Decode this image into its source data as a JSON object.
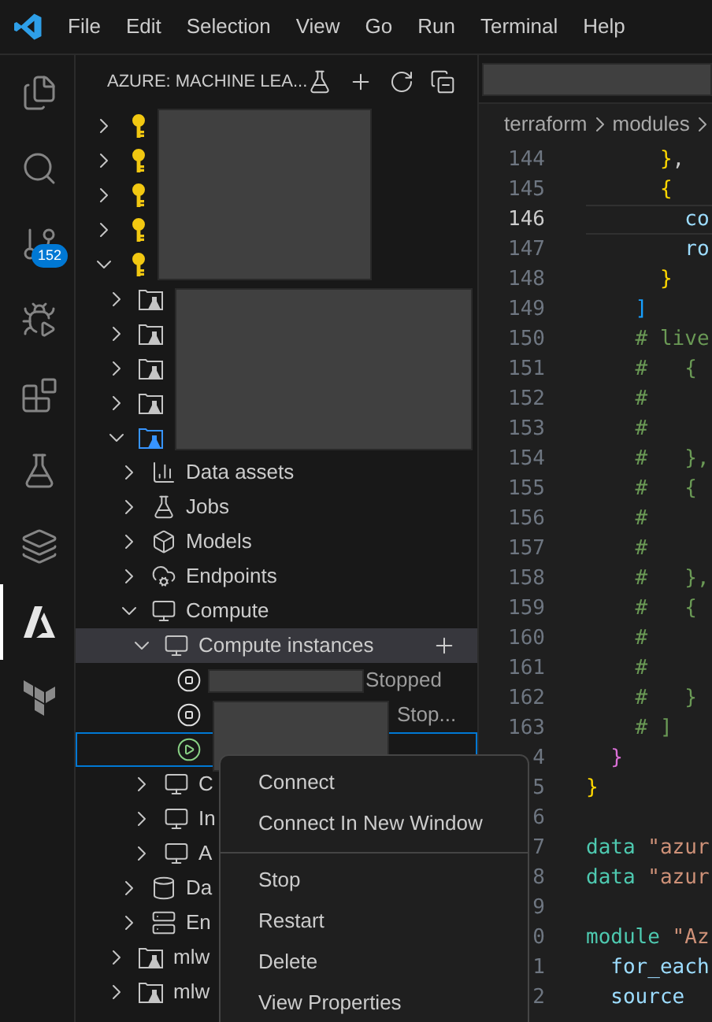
{
  "title_bar": {
    "menus": [
      "File",
      "Edit",
      "Selection",
      "View",
      "Go",
      "Run",
      "Terminal",
      "Help"
    ]
  },
  "activity_bar": [
    {
      "kind": "explorer",
      "selected": false
    },
    {
      "kind": "search",
      "selected": false
    },
    {
      "kind": "scm",
      "selected": false,
      "badge": "152"
    },
    {
      "kind": "debug",
      "selected": false
    },
    {
      "kind": "extensions",
      "selected": false
    },
    {
      "kind": "testing",
      "selected": false
    },
    {
      "kind": "layers",
      "selected": false
    },
    {
      "kind": "azure",
      "selected": true
    },
    {
      "kind": "terraform",
      "selected": false
    }
  ],
  "sidebar": {
    "title": "AZURE: MACHINE LEA...",
    "tree": [
      {
        "kind": "subscription",
        "expanded": false,
        "selected": false
      },
      {
        "kind": "subscription",
        "expanded": false,
        "selected": false
      },
      {
        "kind": "subscription",
        "expanded": false,
        "selected": false
      },
      {
        "kind": "subscription",
        "expanded": false,
        "selected": false
      },
      {
        "kind": "subscription",
        "expanded": true,
        "selected": false,
        "children": [
          {
            "kind": "workspace",
            "expanded": false,
            "selected": false
          },
          {
            "kind": "workspace",
            "expanded": false,
            "selected": false
          },
          {
            "kind": "workspace",
            "expanded": false,
            "selected": false
          },
          {
            "kind": "workspace",
            "expanded": false,
            "selected": false
          },
          {
            "kind": "defaultworkspace",
            "expanded": true,
            "selected": false,
            "children": [
              {
                "kind": "data",
                "label": "Data assets",
                "expanded": false,
                "selected": false
              },
              {
                "kind": "jobs",
                "label": "Jobs",
                "expanded": false,
                "selected": false
              },
              {
                "kind": "models",
                "label": "Models",
                "expanded": false,
                "selected": false
              },
              {
                "kind": "endpoints",
                "label": "Endpoints",
                "expanded": false,
                "selected": false
              },
              {
                "kind": "compute",
                "label": "Compute",
                "expanded": true,
                "selected": false,
                "children": [
                  {
                    "kind": "compute",
                    "label": "Compute instances",
                    "expanded": true,
                    "selected": true,
                    "add_button": true,
                    "children": [
                      {
                        "kind": "stoppedinstance",
                        "status": "Stopped",
                        "selected": false,
                        "focused": false
                      },
                      {
                        "kind": "stoppedinstance",
                        "status": "Stop...",
                        "selected": false,
                        "focused": false
                      },
                      {
                        "kind": "runninginstance",
                        "selected": false,
                        "focused": true
                      }
                    ]
                  },
                  {
                    "kind": "compute",
                    "label": "C",
                    "expanded": false,
                    "selected": false
                  },
                  {
                    "kind": "compute",
                    "label": "In",
                    "expanded": false,
                    "selected": false
                  },
                  {
                    "kind": "compute",
                    "label": "A",
                    "expanded": false,
                    "selected": false
                  }
                ]
              },
              {
                "kind": "datastore",
                "label": "Da",
                "expanded": false,
                "selected": false
              },
              {
                "kind": "environment",
                "label": "En",
                "expanded": false,
                "selected": false
              }
            ]
          },
          {
            "kind": "workspace",
            "label": "mlw",
            "expanded": false,
            "selected": false
          },
          {
            "kind": "workspace",
            "label": "mlw",
            "expanded": false,
            "selected": false
          }
        ]
      }
    ]
  },
  "editor": {
    "breadcrumbs": [
      "terraform",
      "modules"
    ],
    "lines": [
      {
        "n": "144",
        "current": false,
        "tokens": [
          {
            "text": "      }",
            "kind": "gold"
          },
          {
            "text": ",",
            "kind": "plain"
          }
        ]
      },
      {
        "n": "145",
        "current": false,
        "tokens": [
          {
            "text": "      {",
            "kind": "gold"
          }
        ]
      },
      {
        "n": "146",
        "current": true,
        "tokens": [
          {
            "text": "        co",
            "kind": "property"
          }
        ]
      },
      {
        "n": "147",
        "current": false,
        "tokens": [
          {
            "text": "        ro",
            "kind": "property"
          }
        ]
      },
      {
        "n": "148",
        "current": false,
        "tokens": [
          {
            "text": "      }",
            "kind": "gold"
          }
        ]
      },
      {
        "n": "149",
        "current": false,
        "tokens": [
          {
            "text": "    ]",
            "kind": "blue"
          }
        ]
      },
      {
        "n": "150",
        "current": false,
        "tokens": [
          {
            "text": "    # live",
            "kind": "comment"
          }
        ]
      },
      {
        "n": "151",
        "current": false,
        "tokens": [
          {
            "text": "    #   {",
            "kind": "comment"
          }
        ]
      },
      {
        "n": "152",
        "current": false,
        "tokens": [
          {
            "text": "    #",
            "kind": "comment"
          }
        ]
      },
      {
        "n": "153",
        "current": false,
        "tokens": [
          {
            "text": "    #",
            "kind": "comment"
          }
        ]
      },
      {
        "n": "154",
        "current": false,
        "tokens": [
          {
            "text": "    #   },",
            "kind": "comment"
          }
        ]
      },
      {
        "n": "155",
        "current": false,
        "tokens": [
          {
            "text": "    #   {",
            "kind": "comment"
          }
        ]
      },
      {
        "n": "156",
        "current": false,
        "tokens": [
          {
            "text": "    #",
            "kind": "comment"
          }
        ]
      },
      {
        "n": "157",
        "current": false,
        "tokens": [
          {
            "text": "    #",
            "kind": "comment"
          }
        ]
      },
      {
        "n": "158",
        "current": false,
        "tokens": [
          {
            "text": "    #   },",
            "kind": "comment"
          }
        ]
      },
      {
        "n": "159",
        "current": false,
        "tokens": [
          {
            "text": "    #   {",
            "kind": "comment"
          }
        ]
      },
      {
        "n": "160",
        "current": false,
        "tokens": [
          {
            "text": "    #",
            "kind": "comment"
          }
        ]
      },
      {
        "n": "161",
        "current": false,
        "tokens": [
          {
            "text": "    #",
            "kind": "comment"
          }
        ]
      },
      {
        "n": "162",
        "current": false,
        "tokens": [
          {
            "text": "    #   }",
            "kind": "comment"
          }
        ]
      },
      {
        "n": "163",
        "current": false,
        "tokens": [
          {
            "text": "    # ]",
            "kind": "comment"
          }
        ]
      },
      {
        "n": "4",
        "current": false,
        "tokens": [
          {
            "text": "  }",
            "kind": "pink"
          }
        ]
      },
      {
        "n": "5",
        "current": false,
        "tokens": [
          {
            "text": "}",
            "kind": "gold"
          }
        ]
      },
      {
        "n": "6",
        "current": false
      },
      {
        "n": "7",
        "current": false,
        "tokens": [
          {
            "text": "data",
            "kind": "keyword"
          },
          {
            "text": " \"azur",
            "kind": "string"
          }
        ]
      },
      {
        "n": "8",
        "current": false,
        "tokens": [
          {
            "text": "data",
            "kind": "keyword"
          },
          {
            "text": " \"azur",
            "kind": "string"
          }
        ]
      },
      {
        "n": "9",
        "current": false
      },
      {
        "n": "0",
        "current": false,
        "tokens": [
          {
            "text": "module",
            "kind": "keyword"
          },
          {
            "text": " \"Az",
            "kind": "string"
          }
        ]
      },
      {
        "n": "1",
        "current": false,
        "tokens": [
          {
            "text": "  for_each",
            "kind": "property"
          }
        ]
      },
      {
        "n": "2",
        "current": false,
        "tokens": [
          {
            "text": "  source",
            "kind": "property"
          }
        ]
      }
    ]
  },
  "context_menu": [
    {
      "kind": "item",
      "label": "Connect"
    },
    {
      "kind": "item",
      "label": "Connect In New Window"
    },
    {
      "kind": "separator"
    },
    {
      "kind": "item",
      "label": "Stop"
    },
    {
      "kind": "item",
      "label": "Restart"
    },
    {
      "kind": "item",
      "label": "Delete"
    },
    {
      "kind": "item",
      "label": "View Properties"
    }
  ]
}
